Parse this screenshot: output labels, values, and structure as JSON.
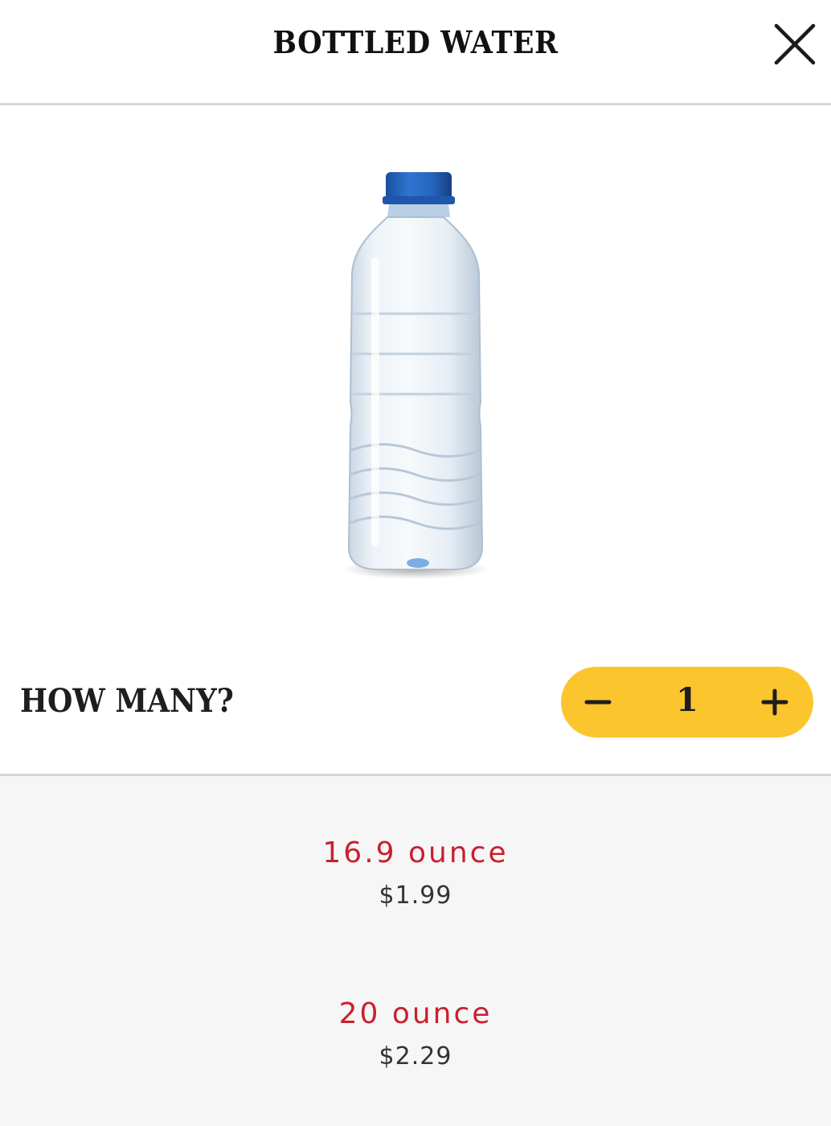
{
  "header": {
    "title": "BOTTLED WATER",
    "close_icon": "close-icon"
  },
  "product": {
    "image_icon": "water-bottle-image",
    "cap_color": "#1f5fbf"
  },
  "quantity": {
    "label": "HOW MANY?",
    "value": "1",
    "minus_icon": "minus-icon",
    "plus_icon": "plus-icon",
    "accent_color": "#fbc52d"
  },
  "options": [
    {
      "size": "16.9 ounce",
      "price": "$1.99"
    },
    {
      "size": "20 ounce",
      "price": "$2.29"
    }
  ],
  "colors": {
    "size_text": "#c8202f",
    "price_text": "#333333",
    "options_bg": "#f6f6f6",
    "divider": "#d6d6d6"
  }
}
